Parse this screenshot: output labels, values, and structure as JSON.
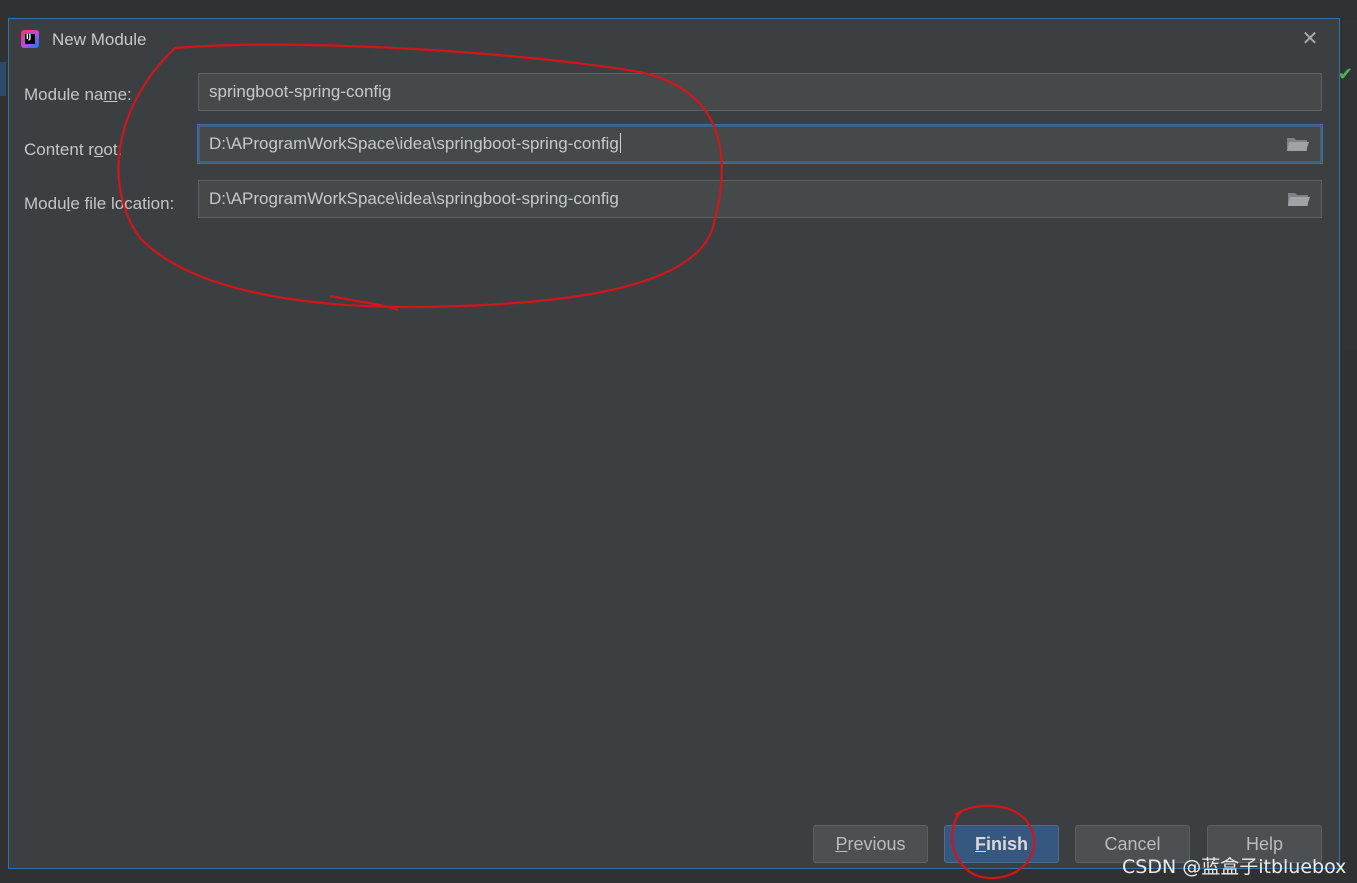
{
  "window": {
    "title": "New Module",
    "app_icon_letters": "IJ"
  },
  "form": {
    "module_name": {
      "label_pre": "Module na",
      "label_mnemonic": "m",
      "label_post": "e:",
      "value": "springboot-spring-config"
    },
    "content_root": {
      "label_pre": "Content r",
      "label_mnemonic": "o",
      "label_post": "ot:",
      "value": "D:\\AProgramWorkSpace\\idea\\springboot-spring-config"
    },
    "module_file_location": {
      "label_pre": "Modu",
      "label_mnemonic": "l",
      "label_post": "e file location:",
      "value": "D:\\AProgramWorkSpace\\idea\\springboot-spring-config"
    }
  },
  "buttons": {
    "previous": {
      "mnemonic": "P",
      "rest": "revious"
    },
    "finish": {
      "mnemonic": "F",
      "rest": "inish"
    },
    "cancel": "Cancel",
    "help": "Help"
  },
  "watermark": "CSDN @蓝盒子itbluebox",
  "colors": {
    "dialog_bg": "#3c3f41",
    "input_bg": "#45494a",
    "focus_border": "#3d6185",
    "primary_button": "#365880",
    "annotation_red": "#d0161b"
  },
  "icons": [
    "intellij-app-icon",
    "close-icon",
    "folder-icon"
  ]
}
